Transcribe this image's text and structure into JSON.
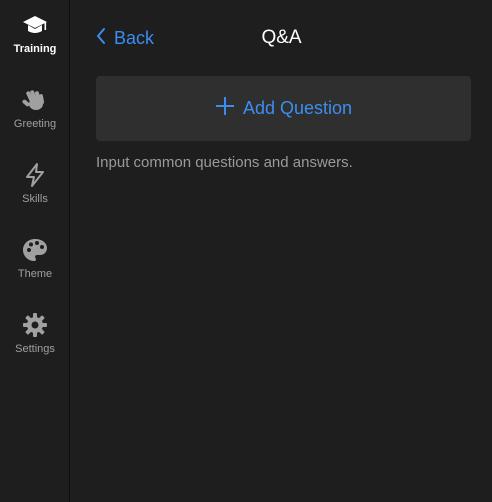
{
  "sidebar": {
    "items": [
      {
        "label": "Training",
        "icon": "graduation-cap-icon",
        "active": true
      },
      {
        "label": "Greeting",
        "icon": "waving-hand-icon",
        "active": false
      },
      {
        "label": "Skills",
        "icon": "lightning-bolt-icon",
        "active": false
      },
      {
        "label": "Theme",
        "icon": "palette-icon",
        "active": false
      },
      {
        "label": "Settings",
        "icon": "gear-icon",
        "active": false
      }
    ]
  },
  "header": {
    "back_label": "Back",
    "title": "Q&A"
  },
  "main": {
    "add_label": "Add Question",
    "hint": "Input common questions and answers."
  },
  "colors": {
    "background": "#1e1e1e",
    "accent": "#3b8ef0",
    "button_bg": "#2f2f2f",
    "muted_text": "#9a9a9a"
  }
}
